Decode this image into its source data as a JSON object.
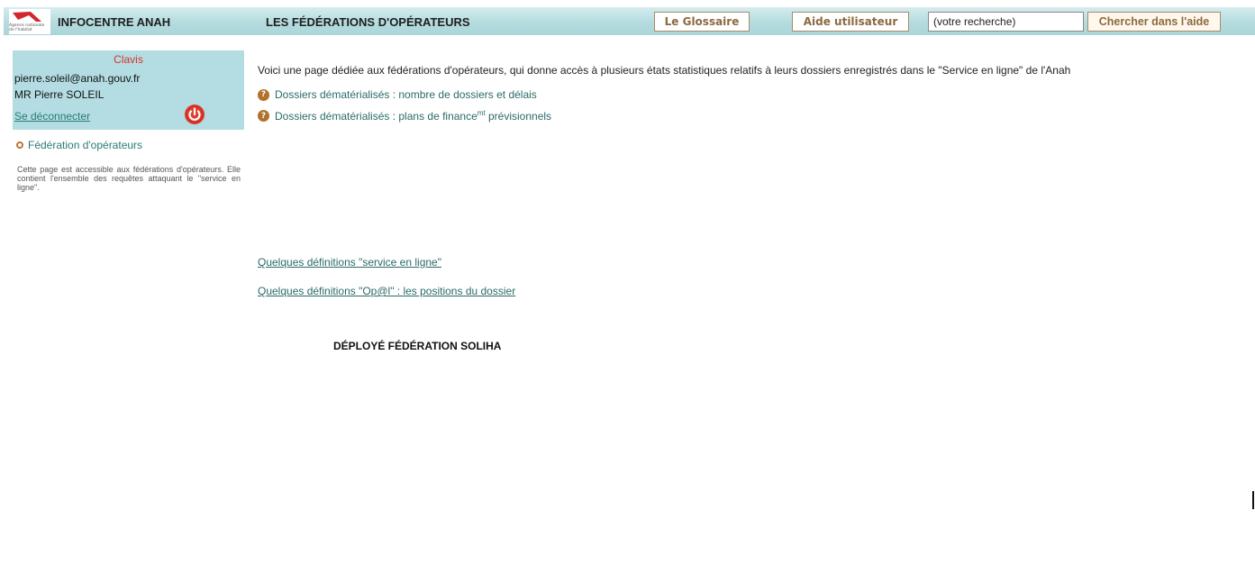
{
  "header": {
    "logo_text": "Agence nationale de l'habitat",
    "app_title": "INFOCENTRE ANAH",
    "page_title": "LES FÉDÉRATIONS D'OPÉRATEURS",
    "glossary_label": "Le Glossaire",
    "help_label": "Aide utilisateur",
    "search_value": "(votre recherche)",
    "search_button_label": "Chercher dans l'aide"
  },
  "user": {
    "app_name": "Clavis",
    "email": "pierre.soleil@anah.gouv.fr",
    "full_name": "MR Pierre SOLEIL",
    "logout_label": "Se déconnecter",
    "logout_icon": "power-icon"
  },
  "sidebar": {
    "nav_item": "Fédération d'opérateurs",
    "description": "Cette page est accessible aux fédérations d'opérateurs. Elle contient l'ensemble des requêtes attaquant le \"service en ligne\"."
  },
  "main": {
    "intro": "Voici une page dédiée aux fédérations d'opérateurs, qui donne accès à plusieurs états statistiques relatifs à leurs dossiers enregistrés dans le \"Service en ligne\" de l'Anah",
    "reports": [
      {
        "label": "Dossiers dématérialisés : nombre de dossiers et délais"
      },
      {
        "label_before": "Dossiers dématérialisés : plans de finance",
        "label_sup": "mt",
        "label_after": " prévisionnels"
      }
    ],
    "definitions": [
      "Quelques définitions \"service en ligne\"",
      "Quelques définitions \"Op@l\" : les positions du dossier"
    ],
    "deployed": "DÉPLOYÉ FÉDÉRATION SOLIHA"
  },
  "colors": {
    "header_bg": "#b7dde0",
    "user_panel_bg": "#b3dde2",
    "link": "#2a6b68",
    "accent_brown": "#8b6a3e",
    "alert_red": "#d6332c"
  }
}
